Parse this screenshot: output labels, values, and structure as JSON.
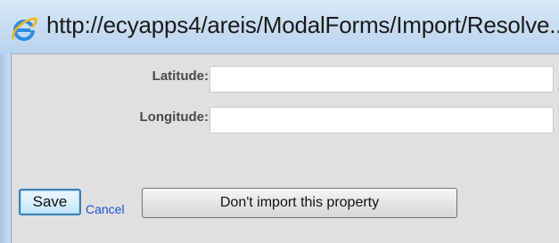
{
  "window": {
    "title": "http://ecyapps4/areis/ModalForms/Import/Resolve...",
    "icon": "internet-explorer-icon"
  },
  "form": {
    "latitude": {
      "label": "Latitude:",
      "value": ""
    },
    "longitude": {
      "label": "Longitude:",
      "value": ""
    }
  },
  "actions": {
    "save_label": "Save",
    "cancel_label": "Cancel",
    "dont_import_label": "Don't import this property"
  },
  "colors": {
    "titlebar": "#c6dcf2",
    "content_background": "#e0e0e0",
    "link": "#1f4fd6",
    "save_border": "#3c7fb1"
  }
}
